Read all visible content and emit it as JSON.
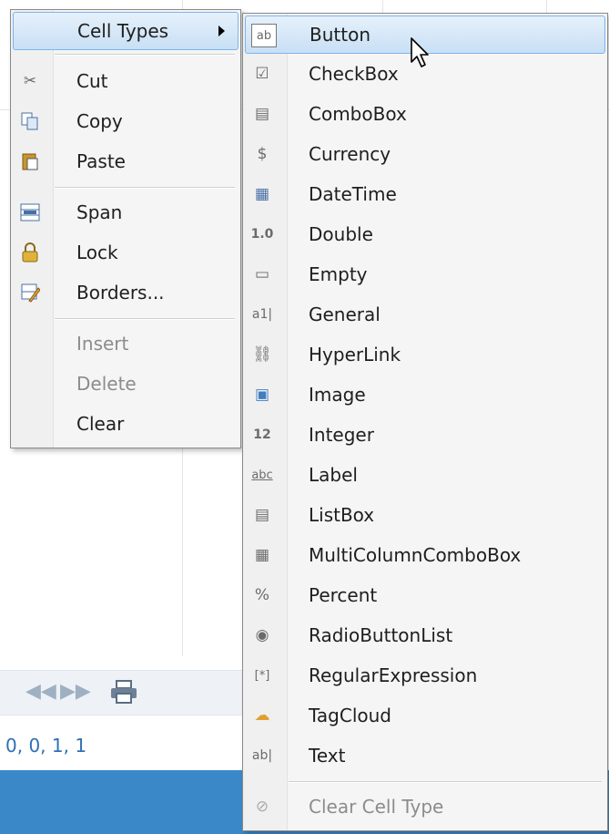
{
  "main_menu": {
    "items": [
      {
        "label": "Cell Types",
        "icon": "none",
        "highlighted": true,
        "has_submenu": true
      },
      {
        "label": "Cut",
        "icon": "scissors-icon"
      },
      {
        "label": "Copy",
        "icon": "copy-icon"
      },
      {
        "label": "Paste",
        "icon": "paste-icon"
      },
      {
        "label": "Span",
        "icon": "span-icon"
      },
      {
        "label": "Lock",
        "icon": "lock-icon"
      },
      {
        "label": "Borders...",
        "icon": "borders-icon"
      },
      {
        "label": "Insert",
        "icon": "none",
        "disabled": true
      },
      {
        "label": "Delete",
        "icon": "none",
        "disabled": true
      },
      {
        "label": "Clear",
        "icon": "none"
      }
    ]
  },
  "sub_menu": {
    "items": [
      {
        "label": "Button",
        "icon_text": "ab",
        "highlighted": true
      },
      {
        "label": "CheckBox",
        "icon_text": "☑"
      },
      {
        "label": "ComboBox",
        "icon_text": "▤"
      },
      {
        "label": "Currency",
        "icon_text": "$"
      },
      {
        "label": "DateTime",
        "icon_text": "▦"
      },
      {
        "label": "Double",
        "icon_text": "1.0"
      },
      {
        "label": "Empty",
        "icon_text": "▭"
      },
      {
        "label": "General",
        "icon_text": "a1|"
      },
      {
        "label": "HyperLink",
        "icon_text": "⛓"
      },
      {
        "label": "Image",
        "icon_text": "▣"
      },
      {
        "label": "Integer",
        "icon_text": "12"
      },
      {
        "label": "Label",
        "icon_text": "abc"
      },
      {
        "label": "ListBox",
        "icon_text": "▤"
      },
      {
        "label": "MultiColumnComboBox",
        "icon_text": "▦"
      },
      {
        "label": "Percent",
        "icon_text": "%"
      },
      {
        "label": "RadioButtonList",
        "icon_text": "◉"
      },
      {
        "label": "RegularExpression",
        "icon_text": "[*]"
      },
      {
        "label": "TagCloud",
        "icon_text": "☁"
      },
      {
        "label": "Text",
        "icon_text": "ab|"
      },
      {
        "label": "Clear Cell Type",
        "icon_text": "⊘",
        "disabled": true
      }
    ]
  },
  "status": {
    "selection_text": "0, 0, 1, 1"
  },
  "colors": {
    "accent": "#3b88c8",
    "highlight_border": "#7eb4ea",
    "status_text": "#2f6fb4"
  }
}
